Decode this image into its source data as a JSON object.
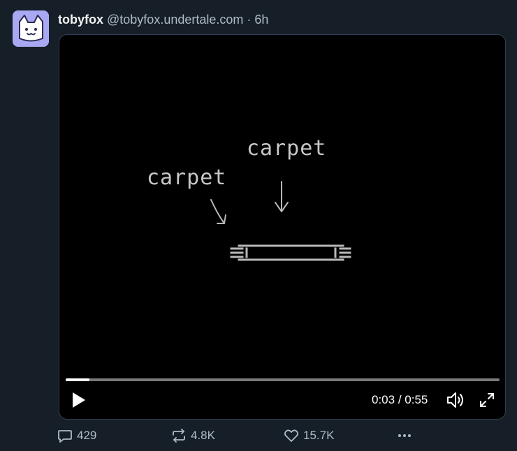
{
  "post": {
    "author": {
      "display_name": "tobyfox",
      "handle": "@tobyfox.undertale.com",
      "separator": "·",
      "timestamp": "6h",
      "avatar_icon": "cat-face-icon",
      "avatar_color": "#a9a9f3"
    },
    "video": {
      "annotations": [
        "carpet",
        "carpet"
      ],
      "progress": 0.054,
      "current_time": "0:03",
      "duration": "0:55",
      "time_separator": " / ",
      "play_icon": "play-icon",
      "volume_icon": "volume-icon",
      "fullscreen_icon": "fullscreen-icon"
    },
    "actions": {
      "reply_count": "429",
      "repost_count": "4.8K",
      "like_count": "15.7K",
      "reply_icon": "comment-icon",
      "repost_icon": "repost-icon",
      "like_icon": "heart-icon",
      "more_icon": "more-icon"
    },
    "colors": {
      "background": "#161e27",
      "muted_text": "#aebbc9",
      "video_background": "#000000",
      "drawing_stroke": "#b8b8b8"
    }
  }
}
